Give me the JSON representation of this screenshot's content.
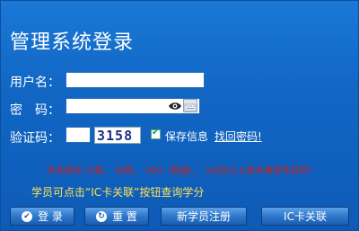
{
  "title": "管理系统登录",
  "labels": {
    "username": "用户名：",
    "password": "密　码：",
    "captcha": "验证码："
  },
  "captcha_value": "3158",
  "save_info": "保存信息",
  "forgot_password": "找回密码!",
  "notice": "本系统在 火狐、 谷歌、 360（极速）、 ie8及以上版本兼容性较好!",
  "tip": "学员可点击“IC卡关联”按钮查询学分",
  "buttons": {
    "login": "登 录",
    "reset": "重 置",
    "register": "新学员注册",
    "ic_card": "IC卡关联"
  },
  "icons": {
    "login": "checkmark-icon",
    "reset": "refresh-icon",
    "eye": "eye-icon",
    "keyboard": "keyboard-icon"
  },
  "colors": {
    "background": "#1166c4",
    "notice": "#c81e1e",
    "tip": "#ffe25a"
  }
}
